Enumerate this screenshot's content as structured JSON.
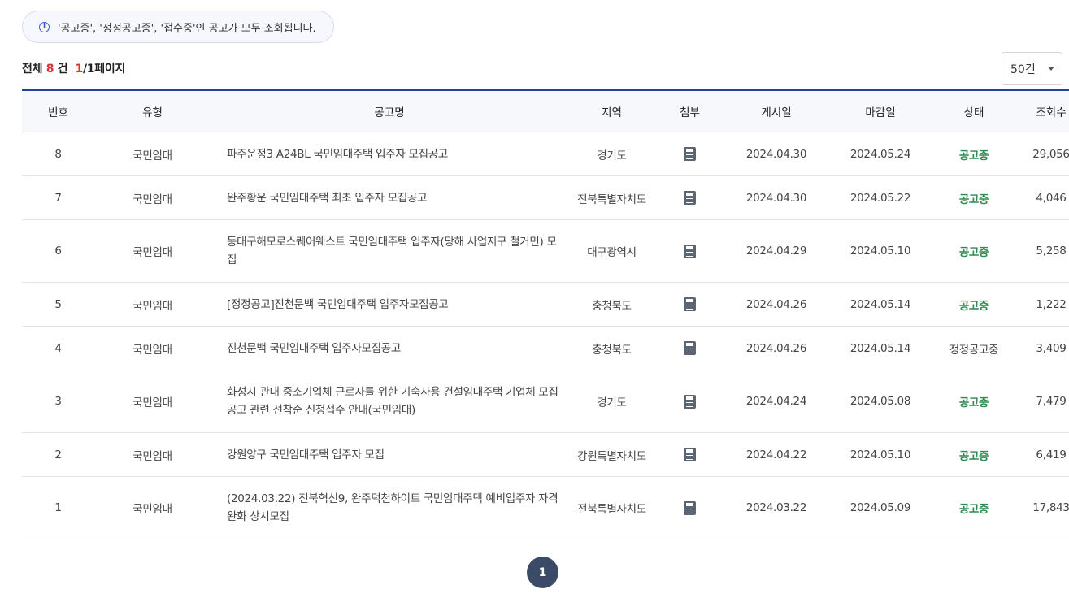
{
  "notice": {
    "icon": "info-icon",
    "text": "'공고중', '정정공고중', '접수중'인 공고가 모두 조회됩니다."
  },
  "summary": {
    "prefix": "전체",
    "total": "8",
    "unit": "건",
    "current_page": "1",
    "page_suffix": "/1페이지"
  },
  "page_size": {
    "selected": "50건"
  },
  "table": {
    "headers": [
      "번호",
      "유형",
      "공고명",
      "지역",
      "첨부",
      "게시일",
      "마감일",
      "상태",
      "조회수"
    ],
    "rows": [
      {
        "no": "8",
        "type": "국민임대",
        "title": "파주운정3 A24BL 국민임대주택 입주자 모집공고",
        "region": "경기도",
        "posted": "2024.04.30",
        "deadline": "2024.05.24",
        "status": "공고중",
        "views": "29,056"
      },
      {
        "no": "7",
        "type": "국민임대",
        "title": "완주황운 국민임대주택 최초 입주자 모집공고",
        "region": "전북특별자치도",
        "posted": "2024.04.30",
        "deadline": "2024.05.22",
        "status": "공고중",
        "views": "4,046"
      },
      {
        "no": "6",
        "type": "국민임대",
        "title": "동대구해모로스퀘어웨스트 국민임대주택 입주자(당해 사업지구 철거민) 모집",
        "region": "대구광역시",
        "posted": "2024.04.29",
        "deadline": "2024.05.10",
        "status": "공고중",
        "views": "5,258"
      },
      {
        "no": "5",
        "type": "국민임대",
        "title": "[정정공고]진천문백 국민임대주택 입주자모집공고",
        "region": "충청북도",
        "posted": "2024.04.26",
        "deadline": "2024.05.14",
        "status": "공고중",
        "views": "1,222"
      },
      {
        "no": "4",
        "type": "국민임대",
        "title": "진천문백 국민임대주택 입주자모집공고",
        "region": "충청북도",
        "posted": "2024.04.26",
        "deadline": "2024.05.14",
        "status": "정정공고중",
        "views": "3,409"
      },
      {
        "no": "3",
        "type": "국민임대",
        "title": "화성시 관내 중소기업체 근로자를 위한 기숙사용 건설임대주택 기업체 모집공고 관련 선착순 신청접수 안내(국민임대)",
        "region": "경기도",
        "posted": "2024.04.24",
        "deadline": "2024.05.08",
        "status": "공고중",
        "views": "7,479"
      },
      {
        "no": "2",
        "type": "국민임대",
        "title": "강원양구 국민임대주택 입주자 모집",
        "region": "강원특별자치도",
        "posted": "2024.04.22",
        "deadline": "2024.05.10",
        "status": "공고중",
        "views": "6,419"
      },
      {
        "no": "1",
        "type": "국민임대",
        "title": "(2024.03.22) 전북혁신9, 완주덕천하이트 국민임대주택 예비입주자 자격완화 상시모집",
        "region": "전북특별자치도",
        "posted": "2024.03.22",
        "deadline": "2024.05.09",
        "status": "공고중",
        "views": "17,843"
      }
    ],
    "attachment_icon": "file-icon"
  },
  "pagination": {
    "current": "1"
  },
  "colors": {
    "accent": "#1f4597",
    "status_open": "#2f8a4e",
    "highlight": "#e03131",
    "pager": "#3b4a66"
  }
}
